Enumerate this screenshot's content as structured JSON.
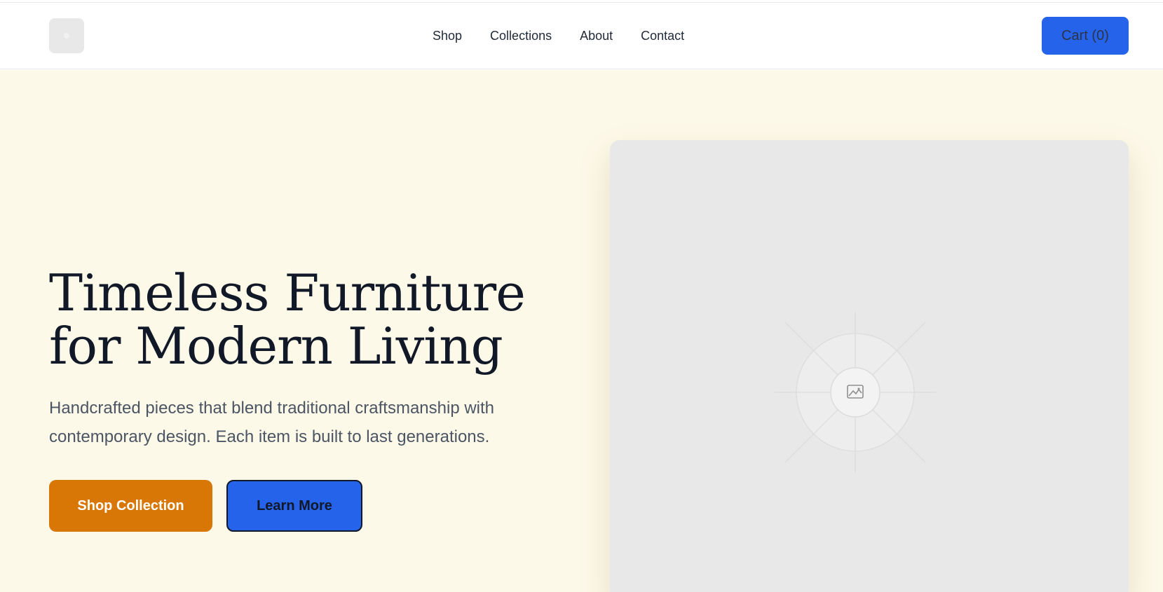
{
  "navbar": {
    "logo_icon": "logo-placeholder-icon",
    "links": [
      "Shop",
      "Collections",
      "About",
      "Contact"
    ],
    "cart_label": "Cart (0)"
  },
  "hero": {
    "title_line1": "Timeless Furniture",
    "title_line2": "for Modern Living",
    "subtitle_line1": "Handcrafted pieces that blend traditional craftsmanship with",
    "subtitle_line2": "contemporary design. Each item is built to last generations.",
    "primary_button": "Shop Collection",
    "secondary_button": "Learn More",
    "image_icon": "image-placeholder-icon"
  },
  "colors": {
    "hero_background": "#fdf9e9",
    "primary_accent": "#d97706",
    "secondary_accent": "#2563eb",
    "heading_text": "#111827",
    "body_text": "#4b5563",
    "placeholder": "#e8e8e8"
  }
}
